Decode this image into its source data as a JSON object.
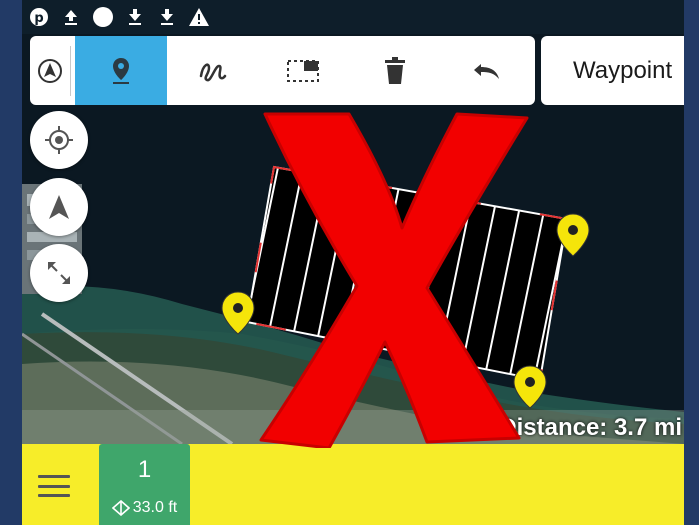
{
  "status_bar": {
    "icons": [
      "pinterest-icon",
      "upload-icon",
      "circle-icon",
      "download-icon",
      "download-icon",
      "warning-icon"
    ]
  },
  "toolbar": {
    "buttons": [
      "compass-north-icon",
      "waypoint-pin-icon",
      "freehand-path-icon",
      "survey-area-icon",
      "trash-icon",
      "undo-icon"
    ],
    "active": "waypoint-pin-icon",
    "active_color": "#3aace3"
  },
  "mode_dropdown": {
    "value": "Waypoint"
  },
  "map_controls": [
    "locate-icon",
    "navigation-arrow-icon",
    "expand-icon"
  ],
  "distance": {
    "label": "Distance: 3.7 mi"
  },
  "bottom_panel": {
    "waypoint": {
      "number": "1",
      "altitude": "33.0 ft"
    }
  },
  "overlay": {
    "symbol": "X",
    "color": "#f20000"
  },
  "colors": {
    "panel": "#f7ed29",
    "card": "#3fa66b",
    "marker": "#f5e50a",
    "grid": "#ffffff"
  }
}
